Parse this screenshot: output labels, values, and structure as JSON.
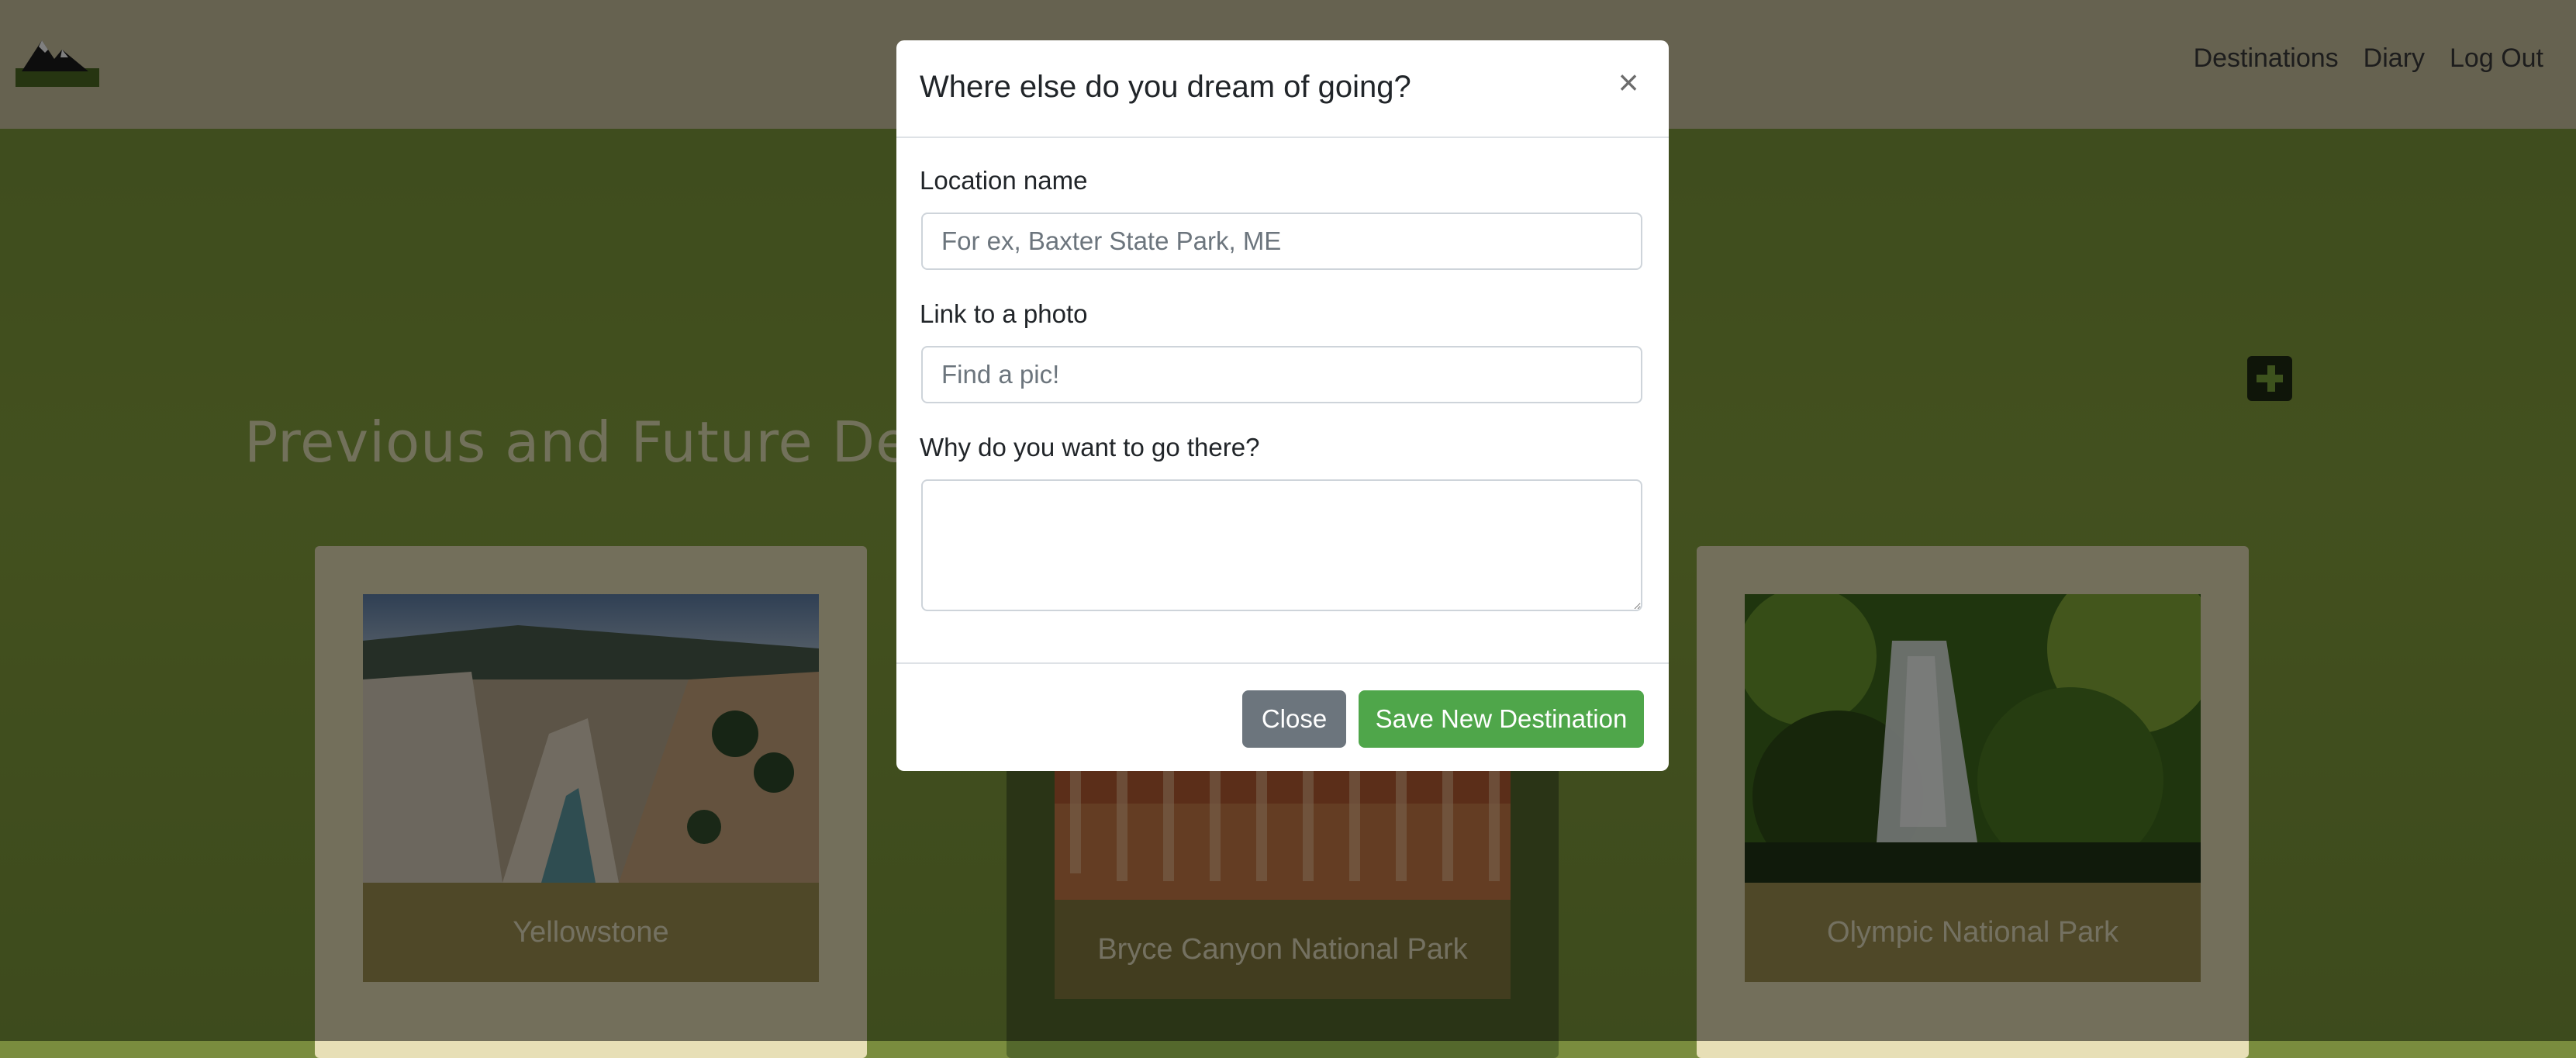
{
  "nav": {
    "links": [
      "Destinations",
      "Diary",
      "Log Out"
    ]
  },
  "page": {
    "title": "Previous and Future Destinations"
  },
  "cards": [
    {
      "caption": "Yellowstone"
    },
    {
      "caption": "Bryce Canyon National Park"
    },
    {
      "caption": "Olympic National Park"
    }
  ],
  "modal": {
    "title": "Where else do you dream of going?",
    "close_x": "×",
    "location_label": "Location name",
    "location_placeholder": "For ex, Baxter State Park, ME",
    "photo_label": "Link to a photo",
    "photo_placeholder": "Find a pic!",
    "why_label": "Why do you want to go there?",
    "why_value": "",
    "close_button": "Close",
    "save_button": "Save New Destination"
  },
  "colors": {
    "navbar": "#ccc4a0",
    "main_bg": "#7e9a3c",
    "save_button": "#4fa64a",
    "close_button": "#6c757d"
  }
}
